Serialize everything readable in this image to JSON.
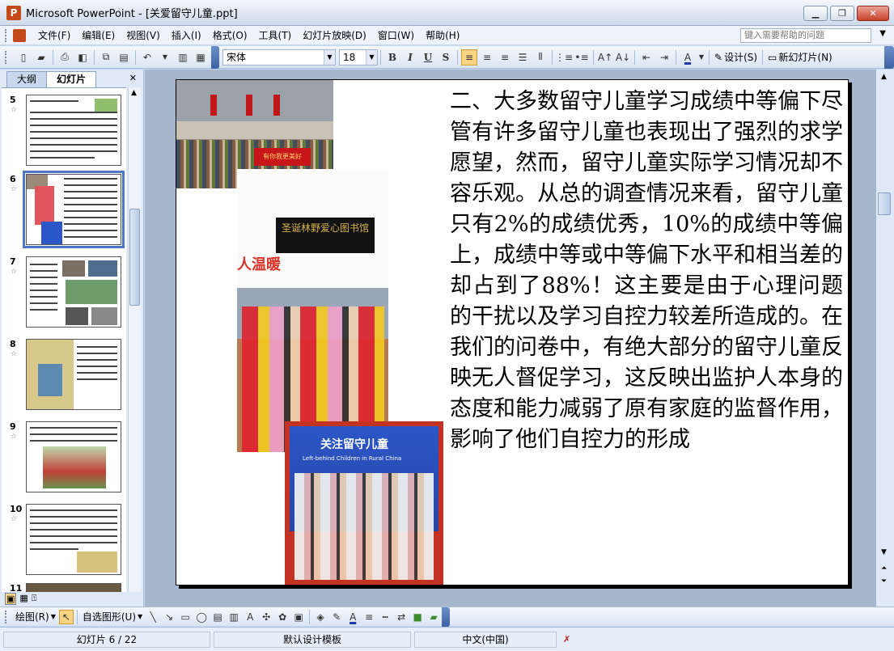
{
  "window": {
    "title": "Microsoft PowerPoint - [关爱留守儿童.ppt]",
    "minimize_icon": "minimize-icon",
    "maximize_icon": "restore-icon",
    "close_icon": "close-icon"
  },
  "menu": {
    "items": [
      "文件(F)",
      "编辑(E)",
      "视图(V)",
      "插入(I)",
      "格式(O)",
      "工具(T)",
      "幻灯片放映(D)",
      "窗口(W)",
      "帮助(H)"
    ],
    "help_placeholder": "键入需要帮助的问题"
  },
  "toolbar": {
    "font_name": "宋体",
    "font_size": "18",
    "bold": "B",
    "italic": "I",
    "underline": "U",
    "shadow": "S",
    "design_label": "设计(S)",
    "new_slide_label": "新幻灯片(N)"
  },
  "left_pane": {
    "tabs": [
      "大纲",
      "幻灯片"
    ],
    "active_tab": "幻灯片",
    "slide_numbers": [
      "5",
      "6",
      "7",
      "8",
      "9",
      "10",
      "11"
    ],
    "selected_slide": "6"
  },
  "slide": {
    "photo1_banner": "有你我更美好",
    "photo2_sign": "圣诞林野爱心图书馆",
    "photo2_caption": "人温暖",
    "photo3_title": "关注留守儿童",
    "photo3_subtitle": "Left-behind Children in Rural China",
    "body_text": "二、大多数留守儿童学习成绩中等偏下尽管有许多留守儿童也表现出了强烈的求学愿望，然而，留守儿童实际学习情况却不容乐观。从总的调查情况来看，留守儿童只有2%的成绩优秀，10%的成绩中等偏上，成绩中等或中等偏下水平和相当差的却占到了88%！这主要是由于心理问题的干扰以及学习自控力较差所造成的。在我们的问卷中，有绝大部分的留守儿童反映无人督促学习，这反映出监护人本身的态度和能力减弱了原有家庭的监督作用，影响了他们自控力的形成"
  },
  "drawbar": {
    "draw_label": "绘图(R)",
    "autoshape_label": "自选图形(U)"
  },
  "status": {
    "slide_indicator": "幻灯片 6 / 22",
    "template": "默认设计模板",
    "language": "中文(中国)"
  }
}
